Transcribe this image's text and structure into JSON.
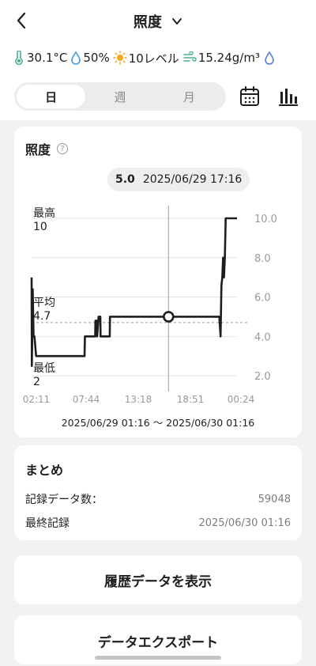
{
  "header": {
    "title": "照度"
  },
  "sensors": [
    {
      "icon": "thermometer-icon",
      "value": "30.1°C"
    },
    {
      "icon": "water-drop-icon",
      "value": "50%"
    },
    {
      "icon": "sun-icon",
      "value": "10レベル"
    },
    {
      "icon": "wind-icon",
      "value": "15.24g/m³"
    }
  ],
  "tabs": {
    "day": "日",
    "week": "週",
    "month": "月",
    "selected": "日"
  },
  "chart_card": {
    "title": "照度",
    "help_symbol": "?",
    "readout_value": "5.0",
    "readout_time": "2025/06/29 17:16",
    "max_label": "最高",
    "max_value": "10",
    "avg_label": "平均",
    "avg_value": "4.7",
    "min_label": "最低",
    "min_value": "2",
    "date_range": "2025/06/29 01:16 〜 2025/06/30 01:16"
  },
  "chart_data": {
    "type": "line",
    "x_ticks": [
      "02:11",
      "07:44",
      "13:18",
      "18:51",
      "00:24"
    ],
    "y_ticks": [
      "2.0",
      "4.0",
      "6.0",
      "8.0",
      "10.0"
    ],
    "ylim": [
      1.2,
      10.0
    ],
    "xlim_hours": [
      1.27,
      25.27
    ],
    "average": 4.7,
    "cursor": {
      "x_time": "17:16",
      "y": 5.0
    },
    "series": [
      {
        "points": [
          [
            1.27,
            7.0
          ],
          [
            1.3,
            2.5
          ],
          [
            1.34,
            4.0
          ],
          [
            1.4,
            6.4
          ],
          [
            1.5,
            4.0
          ],
          [
            1.6,
            4.0
          ],
          [
            1.8,
            3.0
          ],
          [
            7.45,
            3.0
          ],
          [
            7.5,
            4.0
          ],
          [
            8.7,
            4.0
          ],
          [
            8.73,
            4.8
          ],
          [
            8.9,
            4.8
          ],
          [
            8.93,
            4.0
          ],
          [
            9.1,
            5.0
          ],
          [
            9.3,
            5.0
          ],
          [
            9.33,
            4.0
          ],
          [
            10.4,
            4.0
          ],
          [
            10.43,
            5.0
          ],
          [
            17.27,
            5.0
          ],
          [
            23.2,
            5.0
          ],
          [
            23.35,
            4.0
          ],
          [
            23.45,
            6.6
          ],
          [
            23.55,
            7.0
          ],
          [
            23.65,
            8.0
          ],
          [
            23.75,
            7.0
          ],
          [
            23.85,
            8.0
          ],
          [
            23.95,
            10.0
          ],
          [
            25.27,
            10.0
          ]
        ]
      }
    ]
  },
  "summary": {
    "title": "まとめ",
    "count_label": "記録データ数：",
    "count_value": "59048",
    "last_label": "最終記録",
    "last_value": "2025/06/30 01:16"
  },
  "buttons": {
    "history": "履歴データを表示",
    "export": "データエクスポート"
  },
  "colors": {
    "line": "#1e1e1e",
    "cursor": "#a9b7b5",
    "avg_dash": "#9a9a9a",
    "grid": "#e4e4e4",
    "axis_text": "#9a9a9a"
  }
}
